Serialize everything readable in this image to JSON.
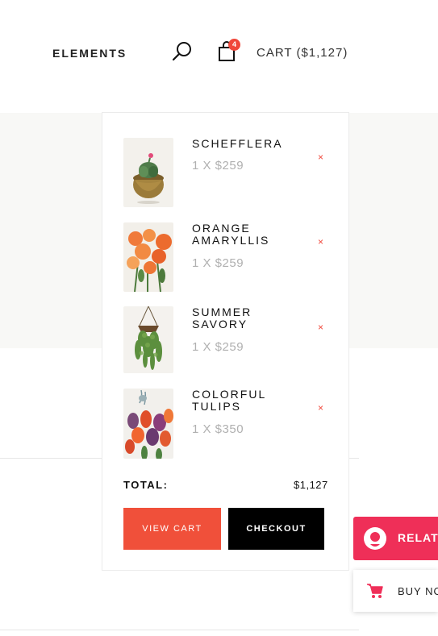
{
  "header": {
    "nav_label": "ELEMENTS",
    "cart_count": "4",
    "cart_label": "CART ($1,127)"
  },
  "minicart": {
    "items": [
      {
        "name": "SCHEFFLERA",
        "qty_price": "1 X $259"
      },
      {
        "name": "ORANGE AMARYLLIS",
        "qty_price": "1 X $259"
      },
      {
        "name": "SUMMER SAVORY",
        "qty_price": "1 X $259"
      },
      {
        "name": "COLORFUL TULIPS",
        "qty_price": "1 X $350"
      }
    ],
    "remove_glyph": "×",
    "total_label": "TOTAL:",
    "total_value": "$1,127",
    "view_cart_label": "VIEW CART",
    "checkout_label": "CHECKOUT"
  },
  "side": {
    "related_label": "RELATE",
    "buy_label": "BUY NO"
  },
  "colors": {
    "accent": "#f0473a",
    "related": "#ef2f58",
    "checkout": "#000000"
  }
}
